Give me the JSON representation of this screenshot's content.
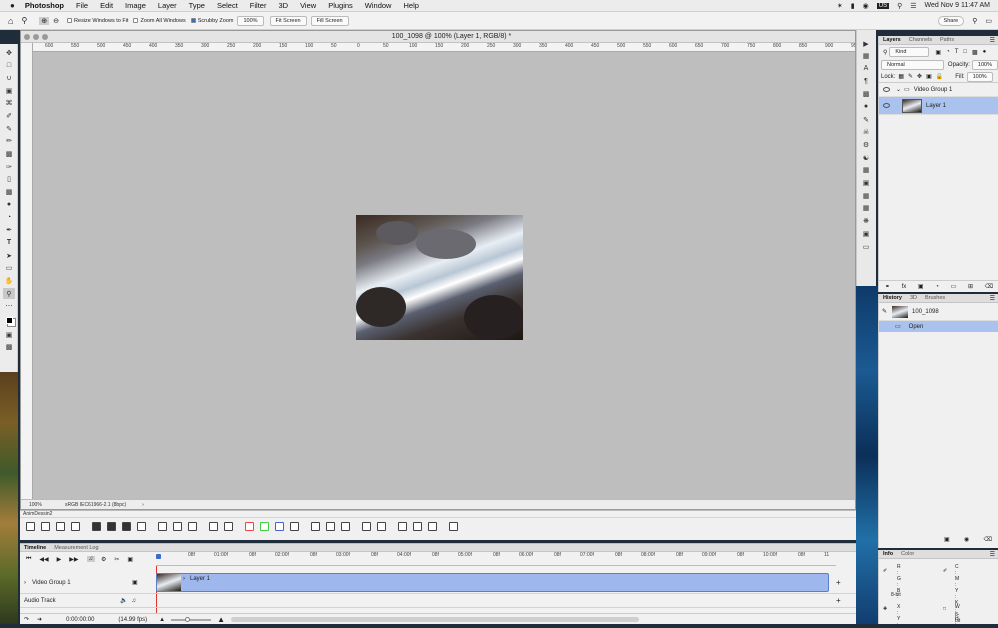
{
  "menubar": {
    "apple": "",
    "app": "Photoshop",
    "items": [
      "File",
      "Edit",
      "Image",
      "Layer",
      "Type",
      "Select",
      "Filter",
      "3D",
      "View",
      "Plugins",
      "Window",
      "Help"
    ],
    "us": "US",
    "clock": "Wed Nov 9  11:47 AM"
  },
  "options": {
    "resize": "Resize Windows to Fit",
    "zoom_all": "Zoom All Windows",
    "scrubby": "Scrubby Zoom",
    "zoom_value": "100%",
    "fit_screen": "Fit Screen",
    "fill_screen": "Fill Screen",
    "share": "Share"
  },
  "document": {
    "title": "100_1098 @ 100% (Layer 1, RGB/8) *",
    "ruler_labels": [
      "600",
      "550",
      "500",
      "450",
      "400",
      "350",
      "300",
      "250",
      "200",
      "150",
      "100",
      "50",
      "0",
      "50",
      "100",
      "150",
      "200",
      "250",
      "300",
      "350",
      "400",
      "450",
      "500",
      "550",
      "600",
      "650",
      "700",
      "750",
      "800",
      "850",
      "900",
      "950"
    ],
    "status_zoom": "100%",
    "status_profile": "sRGB IEC61966-2.1 (8bpc)"
  },
  "animdessin": {
    "title": "AnimDessin2"
  },
  "timeline": {
    "tabs": [
      "Timeline",
      "Measurement Log"
    ],
    "ruler": [
      "08f",
      "01:00f",
      "08f",
      "02:00f",
      "08f",
      "03:00f",
      "08f",
      "04:00f",
      "08f",
      "05:00f",
      "08f",
      "06:00f",
      "08f",
      "07:00f",
      "08f",
      "08:00f",
      "08f",
      "09:00f",
      "08f",
      "10:00f",
      "08f",
      "11"
    ],
    "group_label": "Video Group 1",
    "layer_label": "Layer 1",
    "audio_label": "Audio Track",
    "timecode": "0:00:00:00",
    "fps": "(14.99 fps)"
  },
  "layers": {
    "tabs": [
      "Layers",
      "Channels",
      "Paths"
    ],
    "kind": "Kind",
    "blend": "Normal",
    "opacity_label": "Opacity:",
    "opacity": "100%",
    "lock_label": "Lock:",
    "fill_label": "Fill:",
    "fill": "100%",
    "group": "Video Group 1",
    "layer": "Layer 1"
  },
  "history": {
    "tabs": [
      "History",
      "3D",
      "Brushes"
    ],
    "snapshot": "100_1098",
    "state": "Open"
  },
  "info": {
    "tabs": [
      "Info",
      "Color"
    ],
    "rgb": [
      "R :",
      "G :",
      "B :"
    ],
    "bits": "8-bit",
    "cmyk": [
      "C :",
      "M :",
      "Y :",
      "K :"
    ],
    "xy": [
      "X :",
      "Y :"
    ],
    "wh": [
      "W :",
      "H :"
    ]
  },
  "colors": {
    "selection": "#a9c3ee",
    "clip": "#9eb7ec"
  }
}
